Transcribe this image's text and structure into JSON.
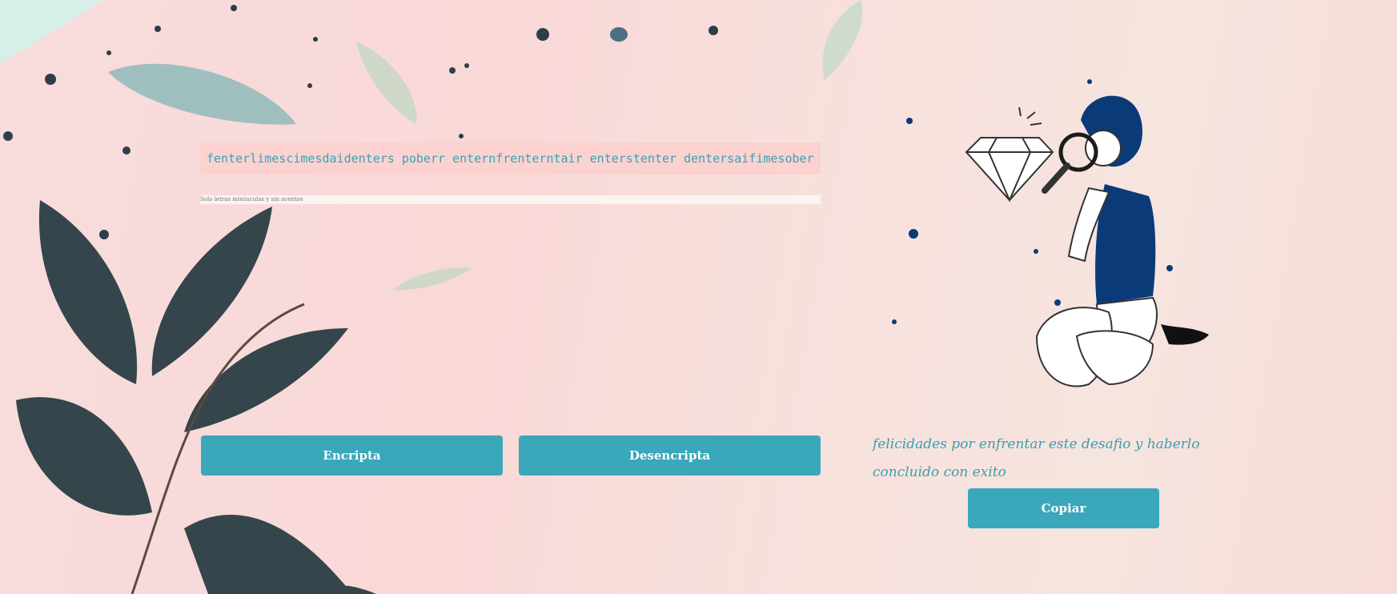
{
  "input": {
    "value": "fenterlimescimesdaidenters poberr enternfrenterntair enterstenter dentersaifimesober y hai"
  },
  "hint": {
    "text": "Solo letras minúsculas y sin acentos"
  },
  "buttons": {
    "encrypt_label": "Encripta",
    "decrypt_label": "Desencripta",
    "copy_label": "Copiar"
  },
  "output": {
    "text": "felicidades por enfrentar este desafio y haberlo concluido con exito"
  },
  "colors": {
    "accent": "#3aa7bb",
    "input_background": "#fbd2d0",
    "illustration_blue": "#0b3a78"
  }
}
